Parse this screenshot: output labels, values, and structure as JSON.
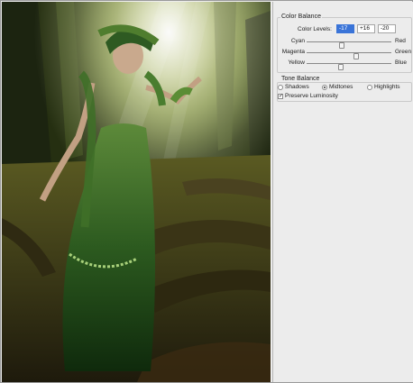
{
  "panel": {
    "color_balance": {
      "title": "Color Balance",
      "levels_label": "Color Levels:",
      "levels": [
        "-17",
        "+16",
        "-20"
      ],
      "sliders": [
        {
          "left": "Cyan",
          "right": "Red",
          "value": -17
        },
        {
          "left": "Magenta",
          "right": "Green",
          "value": 16
        },
        {
          "left": "Yellow",
          "right": "Blue",
          "value": -20
        }
      ]
    },
    "tone_balance": {
      "title": "Tone Balance",
      "options": [
        {
          "label": "Shadows",
          "selected": false
        },
        {
          "label": "Midtones",
          "selected": true
        },
        {
          "label": "Highlights",
          "selected": false
        }
      ],
      "preserve_luminosity": {
        "label": "Preserve Luminosity",
        "checked": true
      }
    }
  },
  "colors": {
    "selection_blue": "#3a74d8",
    "panel_bg": "#ececec"
  }
}
